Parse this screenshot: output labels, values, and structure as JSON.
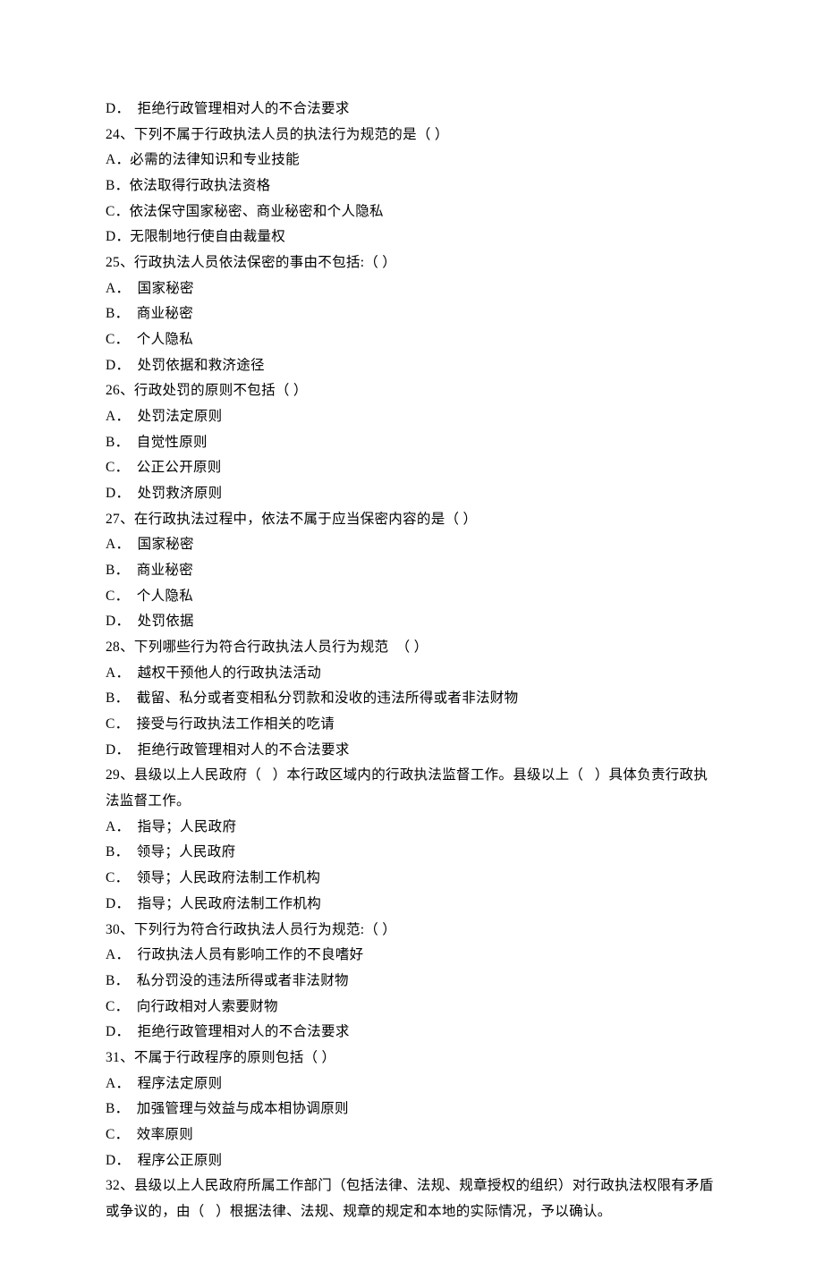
{
  "lines": [
    "D．  拒绝行政管理相对人的不合法要求",
    "24、下列不属于行政执法人员的执法行为规范的是（ ）",
    "A．必需的法律知识和专业技能",
    "B．依法取得行政执法资格",
    "C．依法保守国家秘密、商业秘密和个人隐私",
    "D．无限制地行使自由裁量权",
    "25、行政执法人员依法保密的事由不包括:（ ）",
    "A．  国家秘密",
    "B．  商业秘密",
    "C．  个人隐私",
    "D．  处罚依据和救济途径",
    "26、行政处罚的原则不包括（ ）",
    "A．  处罚法定原则",
    "B．  自觉性原则",
    "C．  公正公开原则",
    "D．  处罚救济原则",
    "27、在行政执法过程中，依法不属于应当保密内容的是（ ）",
    "A．  国家秘密",
    "B．  商业秘密",
    "C．  个人隐私",
    "D．  处罚依据",
    "28、下列哪些行为符合行政执法人员行为规范  （ ）",
    "A．  越权干预他人的行政执法活动",
    "B．  截留、私分或者变相私分罚款和没收的违法所得或者非法财物",
    "C．  接受与行政执法工作相关的吃请",
    "D．  拒绝行政管理相对人的不合法要求",
    "29、县级以上人民政府（   ）本行政区域内的行政执法监督工作。县级以上（   ）具体负责行政执法监督工作。",
    "A．  指导；人民政府",
    "B．  领导；人民政府",
    "C．  领导；人民政府法制工作机构",
    "D．  指导；人民政府法制工作机构",
    "30、下列行为符合行政执法人员行为规范:（ ）",
    "A．  行政执法人员有影响工作的不良嗜好",
    "B．  私分罚没的违法所得或者非法财物",
    "C．  向行政相对人索要财物",
    "D．  拒绝行政管理相对人的不合法要求",
    "31、不属于行政程序的原则包括（ ）",
    "A．  程序法定原则",
    "B．  加强管理与效益与成本相协调原则",
    "C．  效率原则",
    "D．  程序公正原则",
    "32、县级以上人民政府所属工作部门（包括法律、法规、规章授权的组织）对行政执法权限有矛盾或争议的，由（   ）根据法律、法规、规章的规定和本地的实际情况，予以确认。"
  ]
}
